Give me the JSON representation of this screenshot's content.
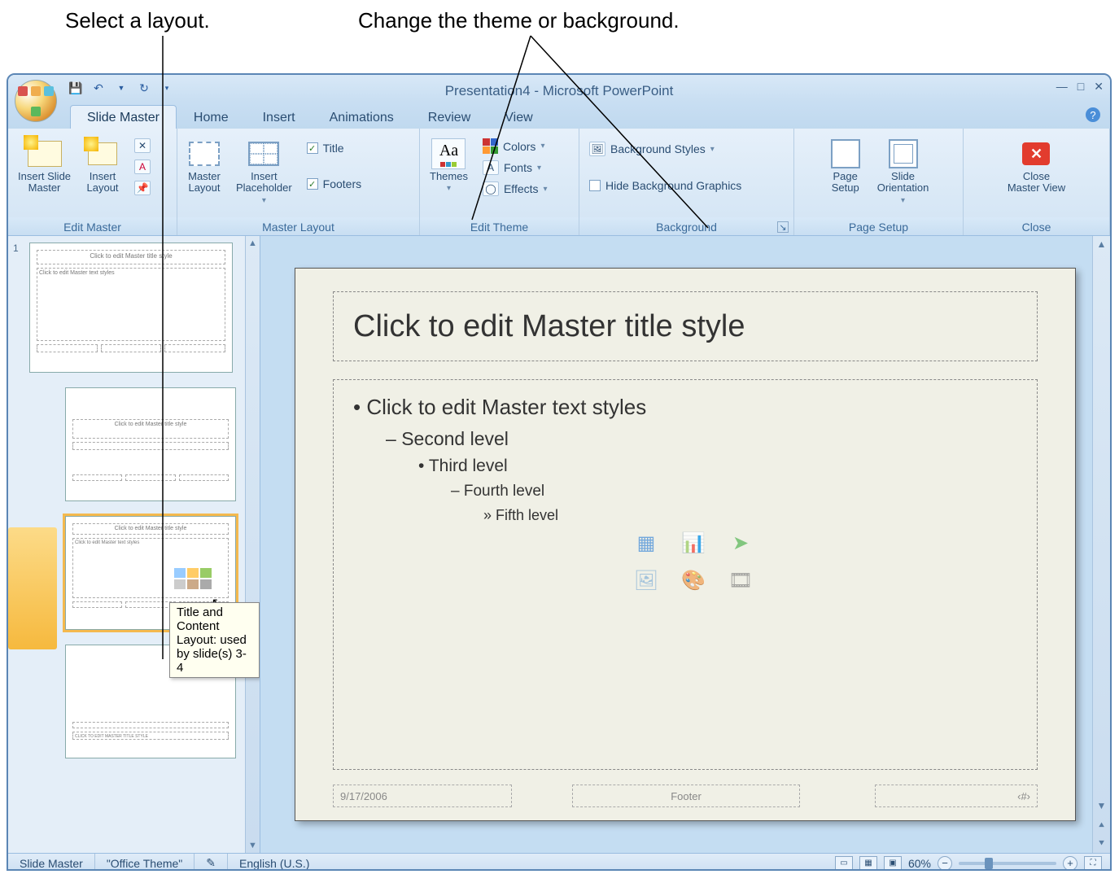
{
  "callouts": {
    "select_layout": "Select a layout.",
    "change_theme": "Change the theme or background."
  },
  "window": {
    "title": "Presentation4 - Microsoft PowerPoint"
  },
  "tabs": {
    "slide_master": "Slide Master",
    "home": "Home",
    "insert": "Insert",
    "animations": "Animations",
    "review": "Review",
    "view": "View"
  },
  "ribbon": {
    "edit_master": {
      "label": "Edit Master",
      "insert_slide_master": "Insert Slide\nMaster",
      "insert_layout": "Insert\nLayout"
    },
    "master_layout": {
      "label": "Master Layout",
      "master_layout_btn": "Master\nLayout",
      "insert_placeholder": "Insert\nPlaceholder",
      "title": "Title",
      "footers": "Footers"
    },
    "edit_theme": {
      "label": "Edit Theme",
      "themes": "Themes",
      "colors": "Colors",
      "fonts": "Fonts",
      "effects": "Effects"
    },
    "background": {
      "label": "Background",
      "background_styles": "Background Styles",
      "hide_bg_graphics": "Hide Background Graphics"
    },
    "page_setup": {
      "label": "Page Setup",
      "page_setup_btn": "Page\nSetup",
      "slide_orientation": "Slide\nOrientation"
    },
    "close": {
      "label": "Close",
      "close_master_view": "Close\nMaster View"
    }
  },
  "thumbnails": {
    "master_num": "1",
    "master_title": "Click to edit Master title style",
    "master_body": "Click to edit Master text styles",
    "layout_title": "Click to edit Master title style",
    "tooltip": "Title and Content Layout: used by slide(s) 3-4"
  },
  "slide": {
    "title": "Click to edit Master title style",
    "lvl1": "Click to edit Master text styles",
    "lvl2": "Second level",
    "lvl3": "Third level",
    "lvl4": "Fourth level",
    "lvl5": "Fifth level",
    "date": "9/17/2006",
    "footer": "Footer",
    "slidenum": "‹#›"
  },
  "statusbar": {
    "mode": "Slide Master",
    "theme": "\"Office Theme\"",
    "language": "English (U.S.)",
    "zoom": "60%"
  }
}
